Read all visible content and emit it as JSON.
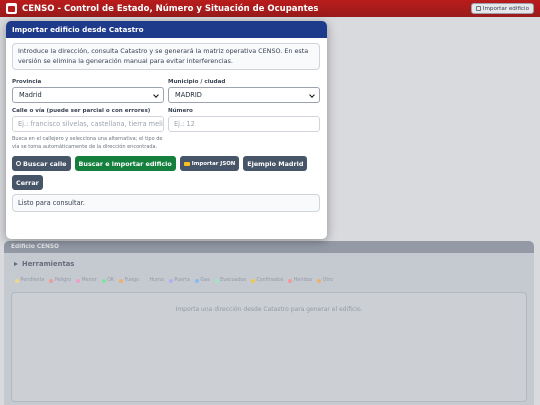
{
  "app": {
    "title": "CENSO - Control de Estado, Número y Situación de Ocupantes",
    "import_button": "Importar edificio"
  },
  "background": {
    "section_title": "Edificio CENSO",
    "tools_label": "Herramientas",
    "legend": [
      {
        "label": "Pendiente",
        "icon": "circle-icon",
        "color": "#fde68a"
      },
      {
        "label": "Peligro",
        "icon": "skull-icon",
        "color": "#fca5a5"
      },
      {
        "label": "Menor",
        "icon": "child-icon",
        "color": "#f9a8d4"
      },
      {
        "label": "OK",
        "icon": "check-icon",
        "color": "#86efac"
      },
      {
        "label": "Fuego",
        "icon": "fire-icon",
        "color": "#fdba74"
      },
      {
        "label": "Humo",
        "icon": "smoke-icon",
        "color": "#d1d5db"
      },
      {
        "label": "Puerta",
        "icon": "door-icon",
        "color": "#c4b5fd"
      },
      {
        "label": "Gas",
        "icon": "gas-icon",
        "color": "#93c5fd"
      },
      {
        "label": "Evacuados",
        "icon": "person-icon",
        "color": "#a7f3d0"
      },
      {
        "label": "Confinados",
        "icon": "house-icon",
        "color": "#fcd34d"
      },
      {
        "label": "Heridos",
        "icon": "cross-icon",
        "color": "#fca5a5"
      },
      {
        "label": "Otro",
        "icon": "tag-icon",
        "color": "#fdba74"
      }
    ],
    "empty_message": "Importa una dirección desde Catastro para generar el edificio."
  },
  "modal": {
    "title": "Importar edificio desde Catastro",
    "info": "Introduce la dirección, consulta Catastro y se generará la matriz operativa CENSO. En esta versión se elimina la generación manual para evitar interferencias.",
    "province": {
      "label": "Provincia",
      "value": "Madrid"
    },
    "municipality": {
      "label": "Municipio / ciudad",
      "value": "MADRID"
    },
    "street": {
      "label": "Calle o vía (puede ser parcial o con errores)",
      "placeholder": "Ej.: francisco silvelas, castellana, tierra melide"
    },
    "number": {
      "label": "Número",
      "placeholder": "Ej.: 12"
    },
    "hint": "Busca en el callejero y selecciona una alternativa; el tipo de vía se toma automáticamente de la dirección encontrada.",
    "buttons": {
      "search_street": "Buscar calle",
      "search_import": "Buscar e importar edificio",
      "import_json": "Importar JSON",
      "example": "Ejemplo Madrid",
      "close": "Cerrar"
    },
    "status": "Listo para consultar."
  }
}
